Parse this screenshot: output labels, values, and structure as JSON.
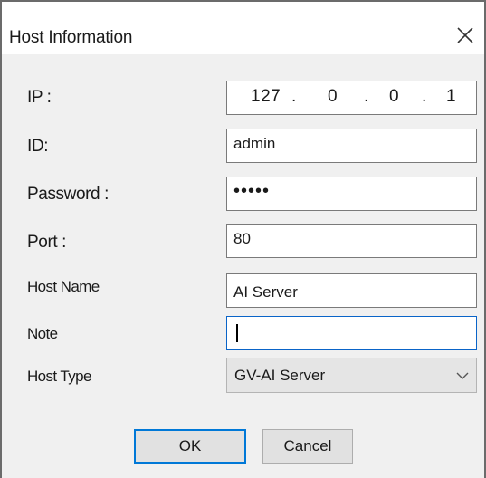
{
  "window": {
    "title": "Host Information"
  },
  "form": {
    "ip": {
      "label": "IP :",
      "octets": [
        "127",
        "0",
        "0",
        "1"
      ],
      "separator": "."
    },
    "id": {
      "label": "ID:",
      "value": "admin"
    },
    "password": {
      "label": "Password :",
      "masked_value": "•••••"
    },
    "port": {
      "label": "Port :",
      "value": "80"
    },
    "host_name": {
      "label": "Host Name",
      "value": "AI Server"
    },
    "note": {
      "label": "Note",
      "value": ""
    },
    "host_type": {
      "label": "Host Type",
      "selected": "GV-AI Server"
    }
  },
  "buttons": {
    "ok_label": "OK",
    "cancel_label": "Cancel"
  },
  "colors": {
    "dialog_bg": "#f0f0f0",
    "focus_border": "#0a64c8",
    "default_button_border": "#0078d7"
  },
  "icons": {
    "close": "close-icon",
    "dropdown": "chevron-down-icon"
  }
}
